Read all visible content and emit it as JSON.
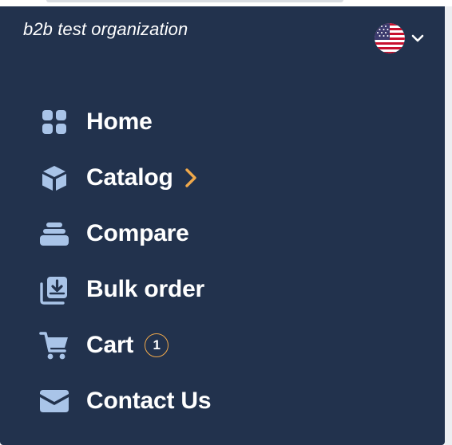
{
  "header": {
    "organization": "b2b test organization",
    "language_flag": "us-flag-icon"
  },
  "menu": {
    "items": [
      {
        "label": "Home",
        "icon": "grid-icon"
      },
      {
        "label": "Catalog",
        "icon": "box-icon",
        "has_submenu": true
      },
      {
        "label": "Compare",
        "icon": "layers-icon"
      },
      {
        "label": "Bulk order",
        "icon": "bulk-download-icon"
      },
      {
        "label": "Cart",
        "icon": "cart-icon",
        "badge": "1"
      },
      {
        "label": "Contact Us",
        "icon": "envelope-icon"
      }
    ]
  },
  "colors": {
    "panel_background": "#22324d",
    "icon": "#a9c4e8",
    "accent": "#f0a94b",
    "text": "#ffffff"
  }
}
